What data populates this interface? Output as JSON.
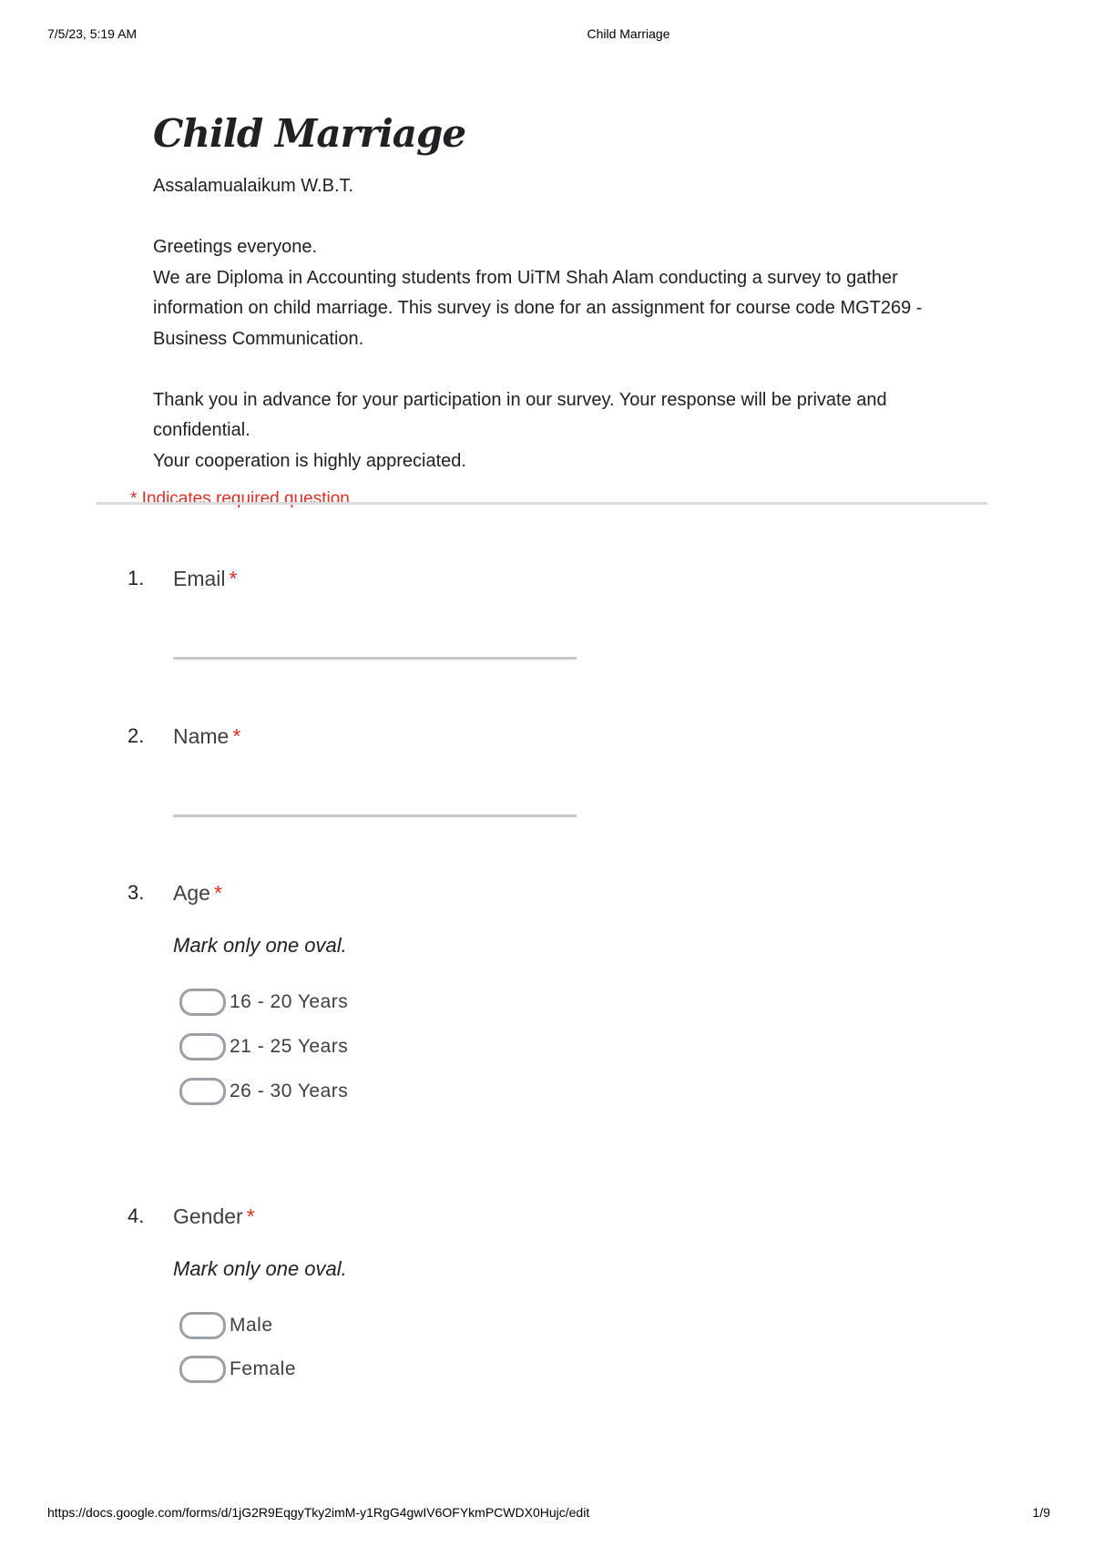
{
  "print_header": {
    "datetime": "7/5/23, 5:19 AM",
    "doc_title": "Child Marriage"
  },
  "form": {
    "title": "Child Marriage",
    "description": [
      "Assalamualaikum W.B.T.",
      "",
      "Greetings everyone.",
      "We are Diploma in Accounting students from UiTM Shah Alam conducting a survey to gather information on child marriage. This survey is done for an assignment for course code MGT269 - Business Communication.",
      "",
      "Thank you in advance for your participation in our survey. Your response will be private and confidential.",
      "Your cooperation is highly appreciated."
    ],
    "required_note": "* Indicates required question"
  },
  "questions": [
    {
      "number": "1.",
      "title": "Email",
      "required_marker": "*",
      "type": "short_text",
      "value": ""
    },
    {
      "number": "2.",
      "title": "Name",
      "required_marker": "*",
      "type": "short_text",
      "value": ""
    },
    {
      "number": "3.",
      "title": "Age",
      "required_marker": "*",
      "type": "single_choice",
      "hint": "Mark only one oval.",
      "options": [
        "16 - 20 Years",
        "21 - 25 Years",
        "26 - 30 Years"
      ]
    },
    {
      "number": "4.",
      "title": "Gender",
      "required_marker": "*",
      "type": "single_choice",
      "hint": "Mark only one oval.",
      "options": [
        "Male",
        "Female"
      ]
    }
  ],
  "print_footer": {
    "url": "https://docs.google.com/forms/d/1jG2R9EqgyTky2imM-y1RgG4gwIV6OFYkmPCWDX0Hujc/edit",
    "page": "1/9"
  },
  "colors": {
    "required": "#d93025",
    "text": "#202124",
    "oval_border": "#9aa0a6",
    "divider": "#dadce0"
  }
}
